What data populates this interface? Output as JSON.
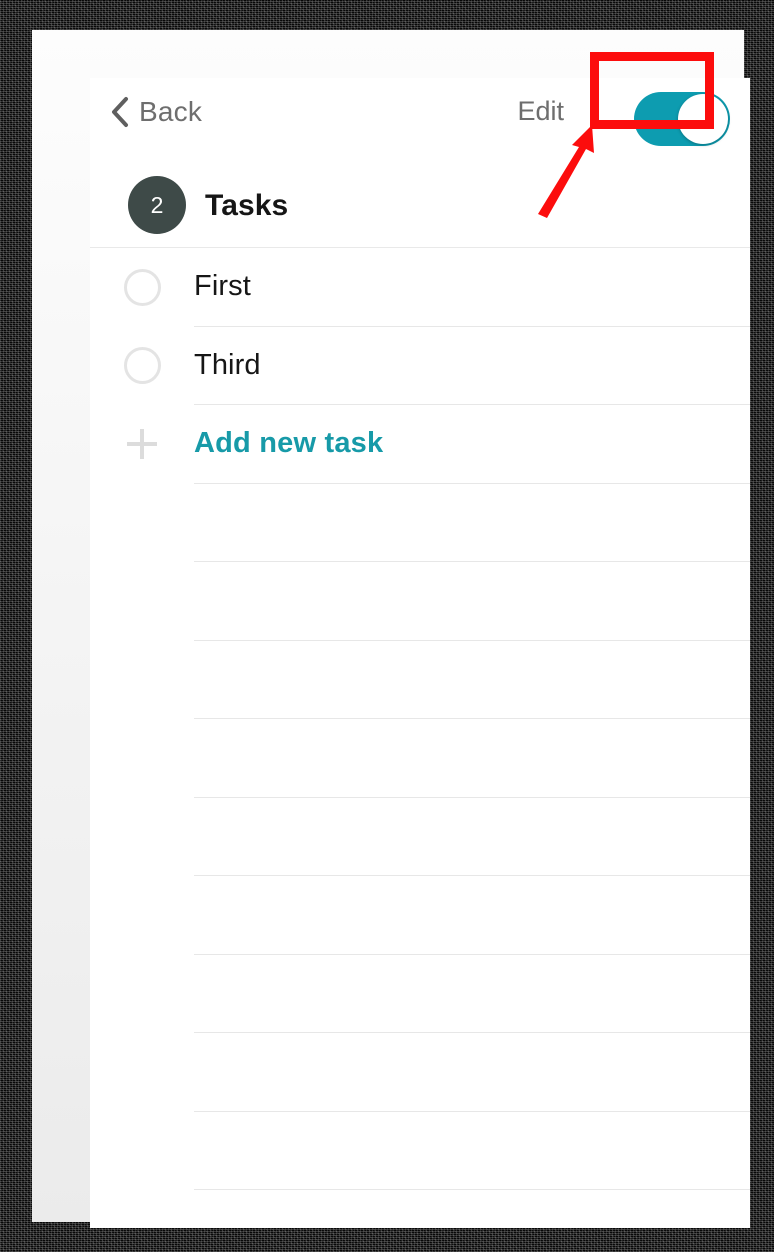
{
  "window": {
    "title": "Tasks"
  },
  "navbar": {
    "back_label": "Back",
    "back_icon": "chevron-left-icon",
    "edit_label": "Edit",
    "toggle": {
      "name": "edit-mode-toggle",
      "state": "on",
      "track_color": "#0d9cb0",
      "knob_color": "#ffffff"
    }
  },
  "section": {
    "count": "2",
    "title": "Tasks",
    "badge_color": "#3e4a48"
  },
  "rows": [
    {
      "type": "task",
      "icon": "circle-unchecked-icon",
      "label": "First"
    },
    {
      "type": "task",
      "icon": "circle-unchecked-icon",
      "label": "Third"
    },
    {
      "type": "add",
      "icon": "plus-icon",
      "label": "Add new task"
    },
    {
      "type": "empty",
      "icon": "",
      "label": ""
    },
    {
      "type": "empty",
      "icon": "",
      "label": ""
    },
    {
      "type": "empty",
      "icon": "",
      "label": ""
    },
    {
      "type": "empty",
      "icon": "",
      "label": ""
    },
    {
      "type": "empty",
      "icon": "",
      "label": ""
    },
    {
      "type": "empty",
      "icon": "",
      "label": ""
    },
    {
      "type": "empty",
      "icon": "",
      "label": ""
    },
    {
      "type": "empty",
      "icon": "",
      "label": ""
    },
    {
      "type": "empty",
      "icon": "",
      "label": ""
    }
  ],
  "annotations": {
    "highlight_color": "#fc0d0d",
    "highlight_target": "edit-mode-toggle",
    "arrow_color": "#fc0d0d"
  },
  "colors": {
    "accent_teal": "#179aa8",
    "text_primary": "#161616",
    "text_muted": "#6e6e6e",
    "separator": "#e7e7e7",
    "card_background": "#ffffff"
  }
}
